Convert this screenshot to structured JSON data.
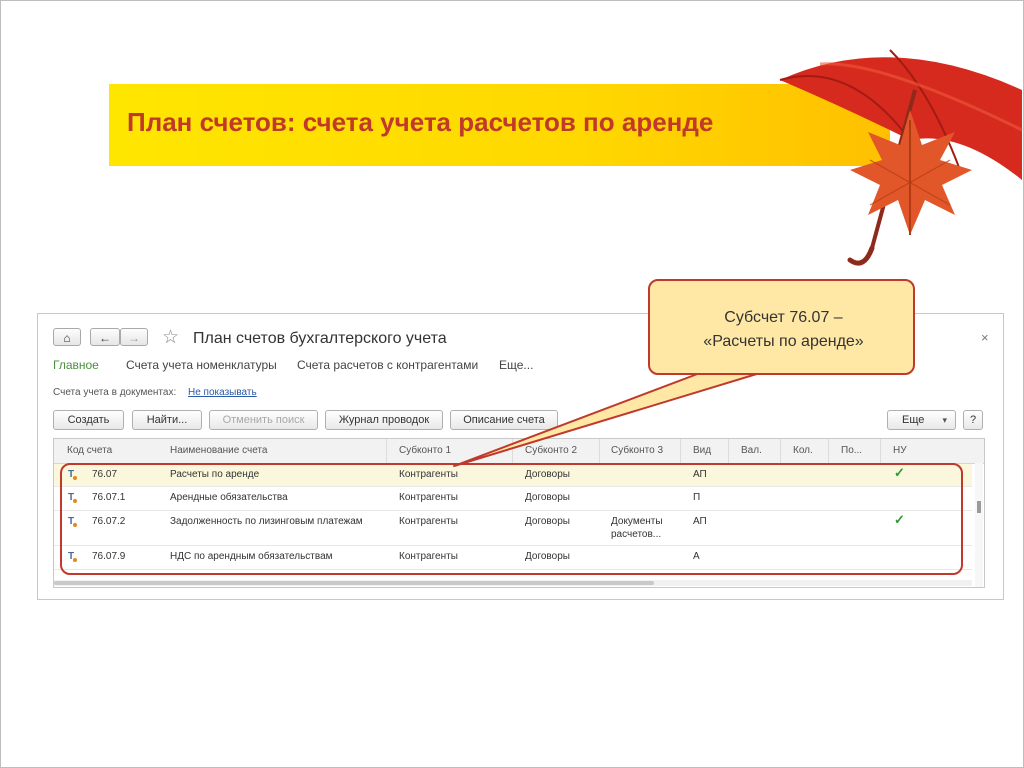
{
  "slide": {
    "title": "План счетов: счета учета расчетов по аренде",
    "callout": {
      "line1": "Субсчет 76.07 –",
      "line2": "«Расчеты по аренде»"
    }
  },
  "window": {
    "nav": {
      "home_icon": "home-icon",
      "back_icon": "arrow-left-icon",
      "forward_icon": "arrow-right-icon",
      "favorite_icon": "star-icon"
    },
    "title": "План счетов бухгалтерского учета",
    "close_label": "×",
    "tabs": [
      "Главное",
      "Счета учета номенклатуры",
      "Счета расчетов с контрагентами",
      "Еще..."
    ],
    "doc_accounts_label": "Счета учета в документах:",
    "doc_accounts_link": "Не показывать",
    "toolbar": {
      "create": "Создать",
      "find": "Найти...",
      "cancel_search": "Отменить поиск",
      "journal": "Журнал проводок",
      "description": "Описание счета",
      "more": "Еще",
      "help": "?"
    },
    "columns": [
      "Код счета",
      "Наименование счета",
      "Субконто 1",
      "Субконто 2",
      "Субконто 3",
      "Вид",
      "Вал.",
      "Кол.",
      "По...",
      "НУ"
    ],
    "rows": [
      {
        "code": "76.07",
        "name": "Расчеты по аренде",
        "sub1": "Контрагенты",
        "sub2": "Договоры",
        "sub3a": "",
        "sub3b": "",
        "vid": "АП",
        "nu": "✓"
      },
      {
        "code": "76.07.1",
        "name": "Арендные обязательства",
        "sub1": "Контрагенты",
        "sub2": "Договоры",
        "sub3a": "",
        "sub3b": "",
        "vid": "П",
        "nu": ""
      },
      {
        "code": "76.07.2",
        "name": "Задолженность по лизинговым платежам",
        "sub1": "Контрагенты",
        "sub2": "Договоры",
        "sub3a": "Документы",
        "sub3b": "расчетов...",
        "vid": "АП",
        "nu": "✓"
      },
      {
        "code": "76.07.9",
        "name": "НДС по арендным обязательствам",
        "sub1": "Контрагенты",
        "sub2": "Договоры",
        "sub3a": "",
        "sub3b": "",
        "vid": "А",
        "nu": ""
      }
    ]
  },
  "colors": {
    "accent_red": "#c0392b",
    "title_yellow": "#ffe600",
    "callout_fill": "#ffe8a6",
    "check_green": "#2f9a2f",
    "tab_active_green": "#4a8f3c"
  },
  "decoration_icons": [
    "umbrella-icon",
    "maple-leaf-icon"
  ]
}
